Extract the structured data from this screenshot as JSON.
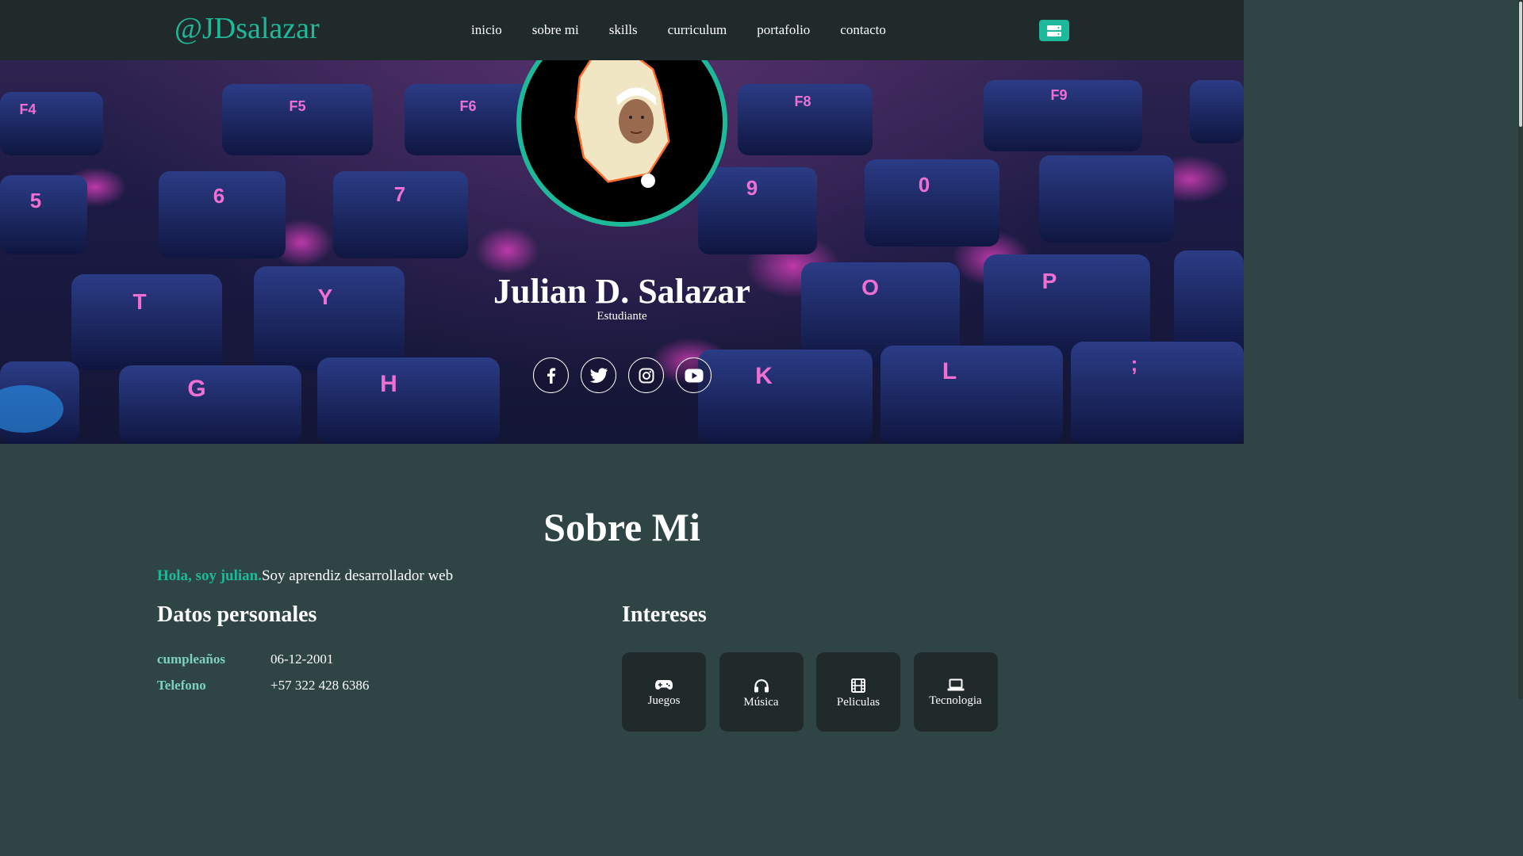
{
  "navbar": {
    "brand": "@JDsalazar",
    "links": [
      "inicio",
      "sobre mi",
      "skills",
      "curriculum",
      "portafolio",
      "contacto"
    ]
  },
  "hero": {
    "name": "Julian D. Salazar",
    "role": "Estudiante",
    "socials": [
      "facebook-icon",
      "twitter-icon",
      "instagram-icon",
      "youtube-icon"
    ],
    "keys": [
      "F4",
      "F5",
      "F6",
      "F8",
      "F9",
      "5",
      "6",
      "7",
      "9",
      "0",
      "T",
      "Y",
      "O",
      "P",
      "G",
      "H",
      "K",
      "L",
      ";"
    ]
  },
  "about": {
    "title": "Sobre Mi",
    "intro_highlight": "Hola, soy julian.",
    "intro_text": "Soy aprendiz desarrollador web",
    "personal_heading": "Datos personales",
    "personal": [
      {
        "label": "cumpleaños",
        "value": "06-12-2001"
      },
      {
        "label": "Telefono",
        "value": "+57 322 428 6386"
      }
    ],
    "interests_heading": "Intereses",
    "interests": [
      {
        "icon": "gamepad-icon",
        "label": "Juegos"
      },
      {
        "icon": "headphones-icon",
        "label": "Música"
      },
      {
        "icon": "film-icon",
        "label": "Peliculas"
      },
      {
        "icon": "laptop-icon",
        "label": "Tecnologia"
      }
    ]
  },
  "colors": {
    "accent": "#1eb89a",
    "navbar_bg": "#212a2a",
    "section_bg": "#2f4545",
    "label": "#7fd0bf"
  }
}
